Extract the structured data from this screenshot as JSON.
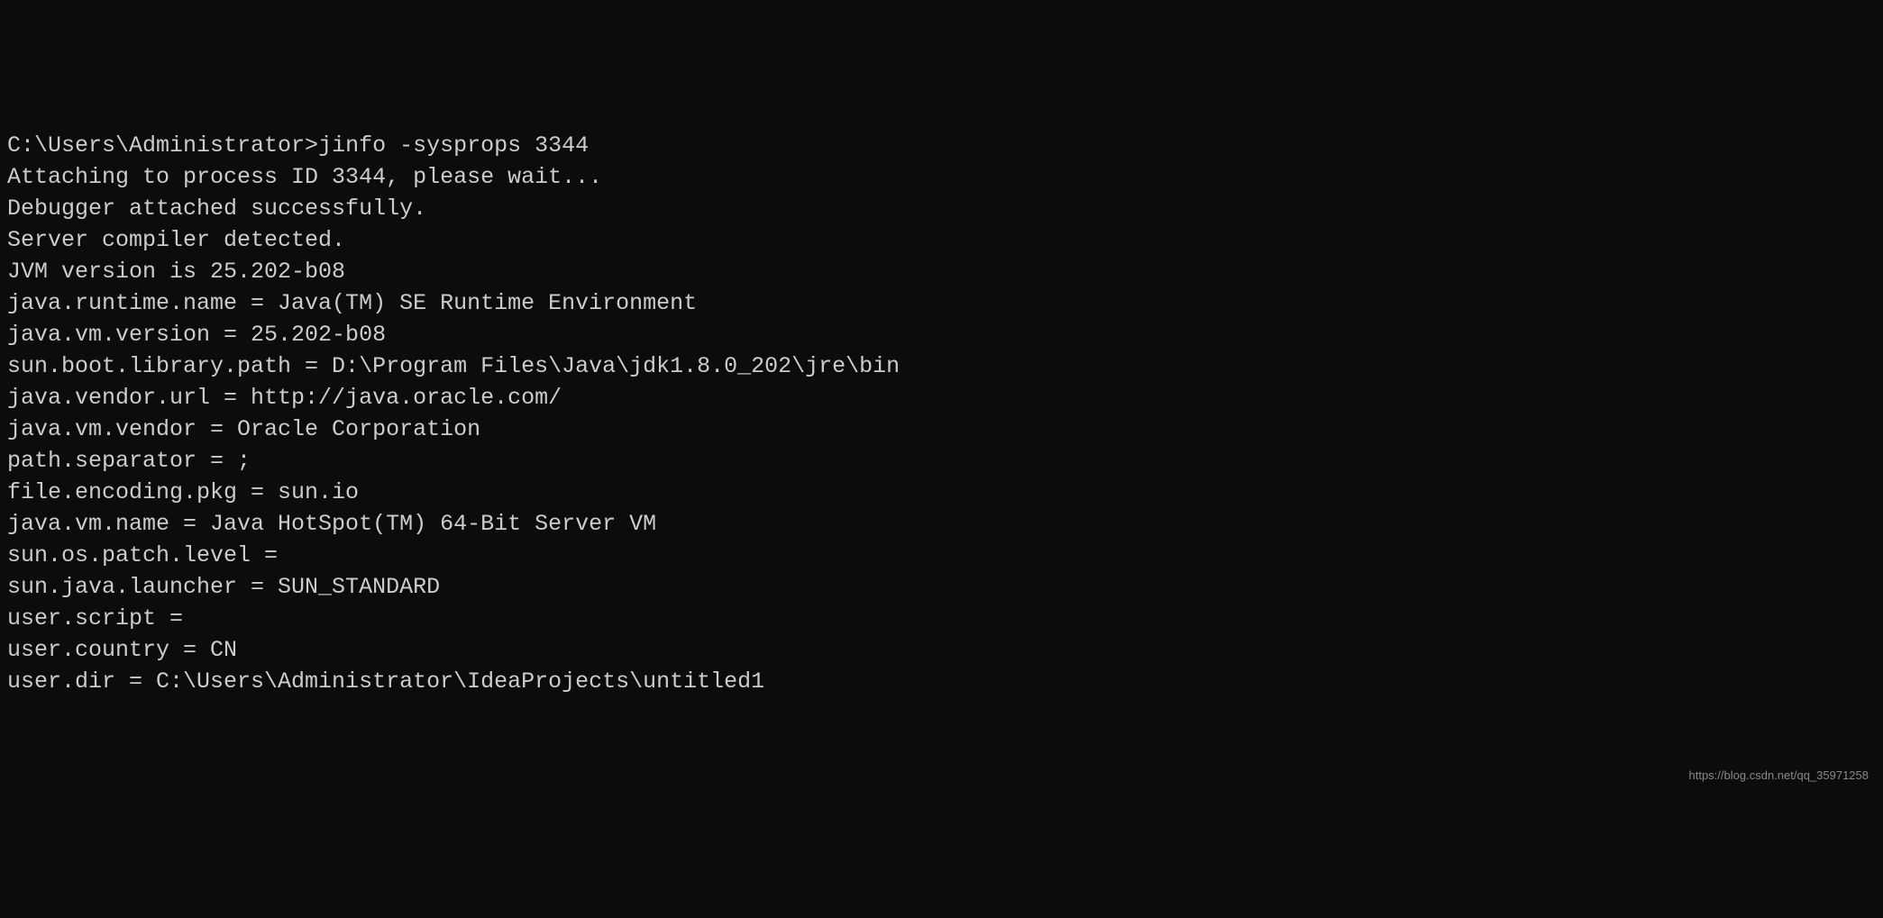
{
  "terminal": {
    "prompt": "C:\\Users\\Administrator>",
    "command": "jinfo -sysprops 3344",
    "lines": [
      "Attaching to process ID 3344, please wait...",
      "Debugger attached successfully.",
      "Server compiler detected.",
      "JVM version is 25.202-b08",
      "java.runtime.name = Java(TM) SE Runtime Environment",
      "java.vm.version = 25.202-b08",
      "sun.boot.library.path = D:\\Program Files\\Java\\jdk1.8.0_202\\jre\\bin",
      "java.vendor.url = http://java.oracle.com/",
      "java.vm.vendor = Oracle Corporation",
      "path.separator = ;",
      "file.encoding.pkg = sun.io",
      "java.vm.name = Java HotSpot(TM) 64-Bit Server VM",
      "sun.os.patch.level =",
      "sun.java.launcher = SUN_STANDARD",
      "user.script =",
      "user.country = CN",
      "user.dir = C:\\Users\\Administrator\\IdeaProjects\\untitled1"
    ]
  },
  "watermark": "https://blog.csdn.net/qq_35971258"
}
